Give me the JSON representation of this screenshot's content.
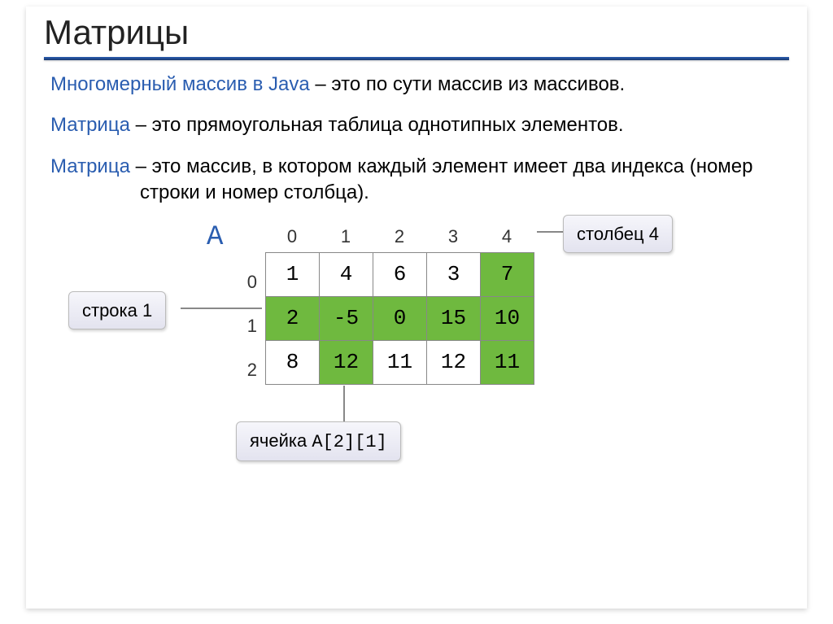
{
  "title": "Матрицы",
  "definitions": [
    {
      "term": "Многомерный массив в Java",
      "text": " – это по сути массив из массивов."
    },
    {
      "term": "Матрица",
      "text": " – это прямоугольная таблица однотипных элементов."
    },
    {
      "term": "Матрица",
      "text": " – это массив, в котором каждый элемент имеет два индекса (номер строки и номер столбца)."
    }
  ],
  "matrix": {
    "name": "A",
    "col_indices": [
      "0",
      "1",
      "2",
      "3",
      "4"
    ],
    "row_indices": [
      "0",
      "1",
      "2"
    ],
    "cells": [
      [
        {
          "v": "1",
          "hl": false
        },
        {
          "v": "4",
          "hl": false
        },
        {
          "v": "6",
          "hl": false
        },
        {
          "v": "3",
          "hl": false
        },
        {
          "v": "7",
          "hl": true
        }
      ],
      [
        {
          "v": "2",
          "hl": true
        },
        {
          "v": "-5",
          "hl": true
        },
        {
          "v": "0",
          "hl": true
        },
        {
          "v": "15",
          "hl": true
        },
        {
          "v": "10",
          "hl": true
        }
      ],
      [
        {
          "v": "8",
          "hl": false
        },
        {
          "v": "12",
          "hl": true
        },
        {
          "v": "11",
          "hl": false
        },
        {
          "v": "12",
          "hl": false
        },
        {
          "v": "11",
          "hl": true
        }
      ]
    ]
  },
  "callouts": {
    "row": "строка 1",
    "col": "столбец 4",
    "cell_prefix": "ячейка ",
    "cell_code": "A[2][1]"
  }
}
